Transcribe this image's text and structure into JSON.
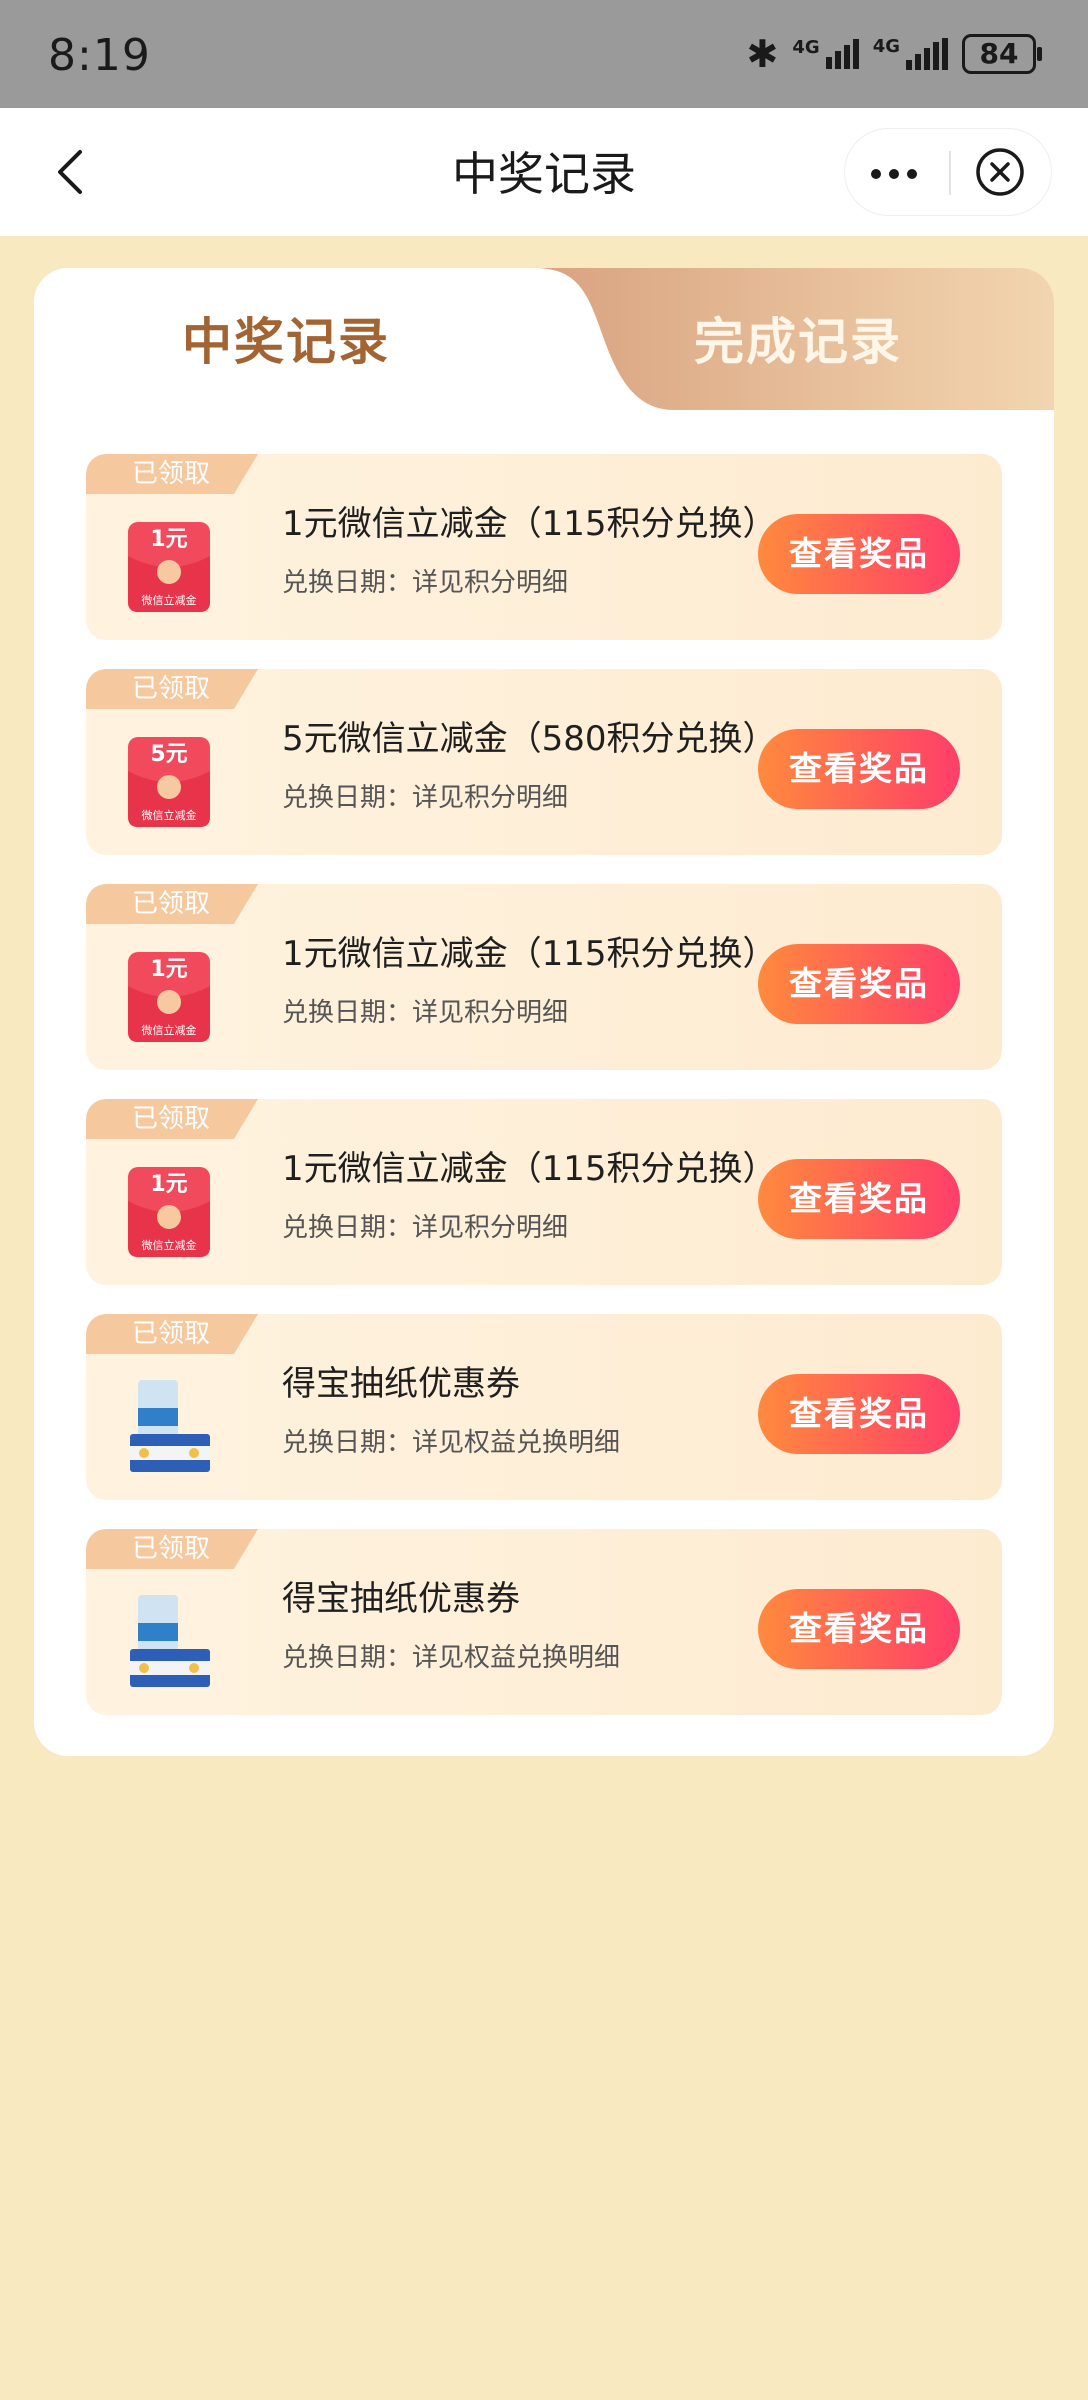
{
  "status_bar": {
    "time": "8:19",
    "network_1": "4G",
    "network_2": "4G",
    "battery": "84"
  },
  "nav": {
    "title": "中奖记录"
  },
  "tabs": [
    {
      "label": "中奖记录",
      "active": true
    },
    {
      "label": "完成记录",
      "active": false
    }
  ],
  "records": [
    {
      "status": "已领取",
      "title": "1元微信立减金（115积分兑换）",
      "subtitle": "兑换日期：详见积分明细",
      "button": "查看奖品",
      "thumb_type": "redpacket",
      "thumb_amount": "1元",
      "thumb_caption": "微信立减金"
    },
    {
      "status": "已领取",
      "title": "5元微信立减金（580积分兑换）",
      "subtitle": "兑换日期：详见积分明细",
      "button": "查看奖品",
      "thumb_type": "redpacket",
      "thumb_amount": "5元",
      "thumb_caption": "微信立减金"
    },
    {
      "status": "已领取",
      "title": "1元微信立减金（115积分兑换）",
      "subtitle": "兑换日期：详见积分明细",
      "button": "查看奖品",
      "thumb_type": "redpacket",
      "thumb_amount": "1元",
      "thumb_caption": "微信立减金"
    },
    {
      "status": "已领取",
      "title": "1元微信立减金（115积分兑换）",
      "subtitle": "兑换日期：详见积分明细",
      "button": "查看奖品",
      "thumb_type": "redpacket",
      "thumb_amount": "1元",
      "thumb_caption": "微信立减金"
    },
    {
      "status": "已领取",
      "title": "得宝抽纸优惠券",
      "subtitle": "兑换日期：详见权益兑换明细",
      "button": "查看奖品",
      "thumb_type": "tissue"
    },
    {
      "status": "已领取",
      "title": "得宝抽纸优惠券",
      "subtitle": "兑换日期：详见权益兑换明细",
      "button": "查看奖品",
      "thumb_type": "tissue"
    }
  ],
  "colors": {
    "page_bg": "#f8e9c0",
    "accent_button": "#ff5a52",
    "tab_active_text": "#a26432"
  }
}
